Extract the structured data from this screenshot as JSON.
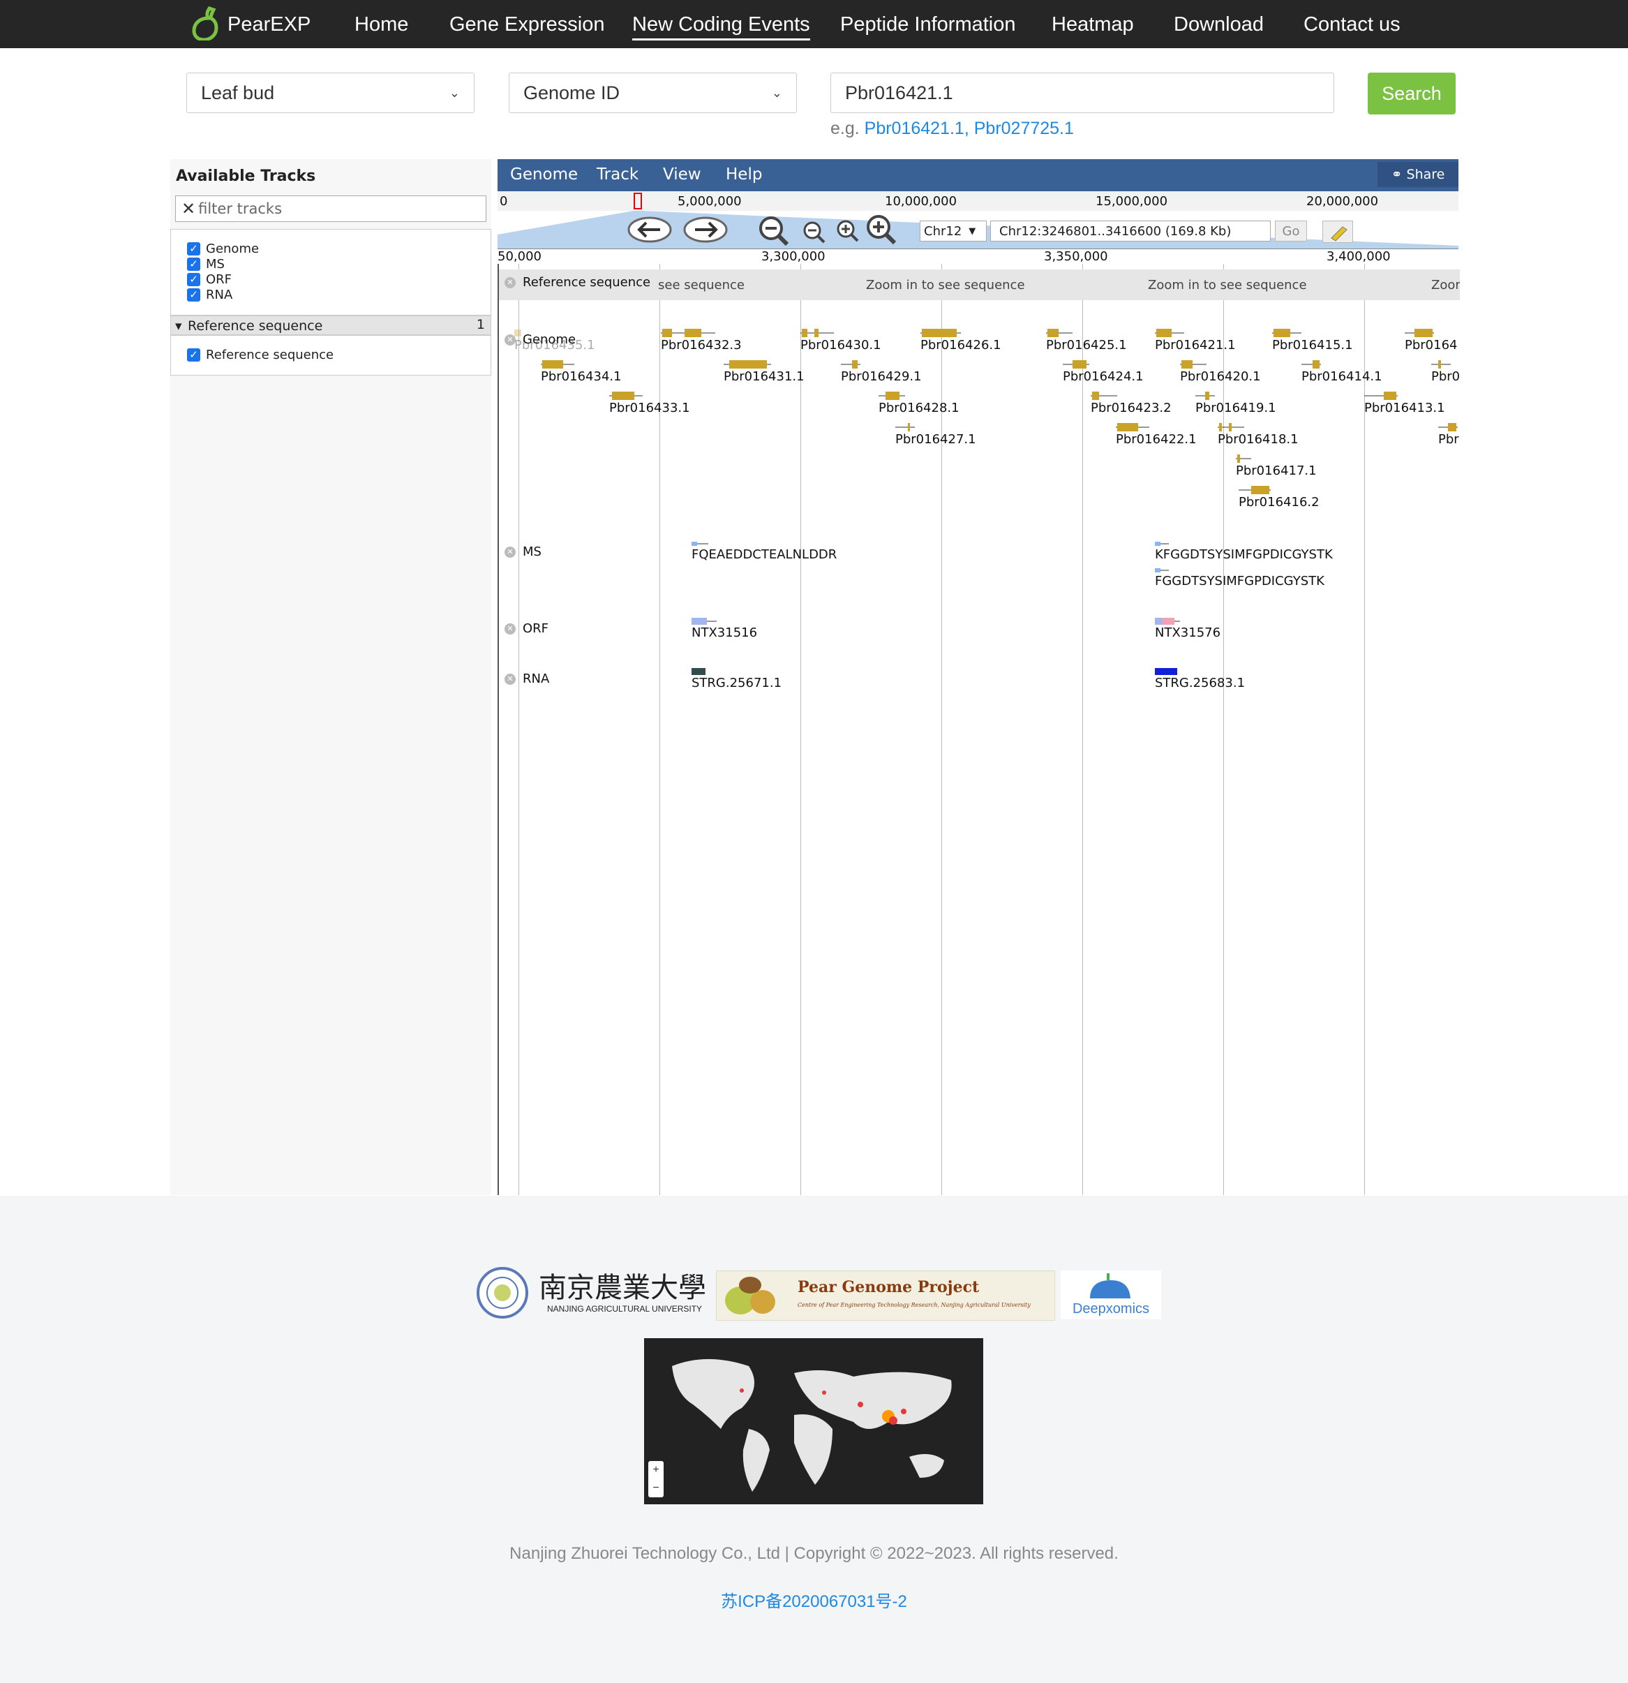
{
  "nav": {
    "brand": "PearEXP",
    "items": [
      "Home",
      "Gene Expression",
      "New Coding Events",
      "Peptide Information",
      "Heatmap",
      "Download",
      "Contact us"
    ],
    "active": "New Coding Events"
  },
  "search": {
    "tissue": "Leaf bud",
    "type": "Genome ID",
    "value": "Pbr016421.1",
    "button": "Search",
    "examples_prefix": "e.g.",
    "example1": "Pbr016421.1,",
    "example2": "Pbr027725.1"
  },
  "tracks_panel": {
    "title": "Available Tracks",
    "filter_placeholder": "filter tracks",
    "tracks": [
      "Genome",
      "MS",
      "ORF",
      "RNA"
    ],
    "category": "Reference sequence",
    "category_count": "1",
    "category_tracks": [
      "Reference sequence"
    ]
  },
  "browser": {
    "menu": [
      "Genome",
      "Track",
      "View",
      "Help"
    ],
    "share": "Share",
    "overview_ticks": [
      "0",
      "5,000,000",
      "10,000,000",
      "15,000,000",
      "20,000,000"
    ],
    "chromosome": "Chr12",
    "location": "Chr12:3246801..3416600 (169.8 Kb)",
    "go": "Go",
    "scale_ticks": [
      "50,000",
      "3,300,000",
      "3,350,000",
      "3,400,000"
    ],
    "ref_track_label": "Reference sequence",
    "zoom_msg": [
      "see sequence",
      "Zoom in to see sequence",
      "Zoom in to see sequence",
      "Zoom"
    ],
    "track_labels": [
      "Genome",
      "MS",
      "ORF",
      "RNA"
    ],
    "genes": [
      "Pbr016435.1",
      "Pbr016432.3",
      "Pbr016430.1",
      "Pbr016426.1",
      "Pbr016425.1",
      "Pbr016421.1",
      "Pbr016415.1",
      "Pbr0164",
      "Pbr016434.1",
      "Pbr016431.1",
      "Pbr016429.1",
      "Pbr016424.1",
      "Pbr016420.1",
      "Pbr016414.1",
      "Pbr0",
      "Pbr016433.1",
      "Pbr016428.1",
      "Pbr016423.2",
      "Pbr016419.1",
      "Pbr016413.1",
      "Pbr016427.1",
      "Pbr016422.1",
      "Pbr016418.1",
      "Pbr",
      "Pbr016417.1",
      "Pbr016416.2"
    ],
    "ms": [
      "FQEAEDDCTEALNLDDR",
      "KFGGDTSYSIMFGPDICGYSTK",
      "FGGDTSYSIMFGPDICGYSTK"
    ],
    "orf": [
      "NTX31516",
      "NTX31576"
    ],
    "rna": [
      "STRG.25671.1",
      "STRG.25683.1"
    ]
  },
  "footer": {
    "logo1_cn": "南京農業大學",
    "logo1_en": "NANJING AGRICULTURAL UNIVERSITY",
    "logo2_title": "Pear Genome Project",
    "logo2_sub": "Centre of Pear Engineering Technology Research, Nanjing Agricultural University",
    "logo3": "Deepxomics",
    "map_plus": "+",
    "map_minus": "−",
    "copyright": "Nanjing Zhuorei Technology Co., Ltd | Copyright © 2022~2023. All rights reserved.",
    "icp": "苏ICP备2020067031号-2"
  },
  "colors": {
    "nav_bg": "#262626",
    "accent_green": "#7cc242",
    "link_blue": "#1e88e5",
    "menubar": "#3a6196",
    "gene_gold": "#c9a227"
  }
}
